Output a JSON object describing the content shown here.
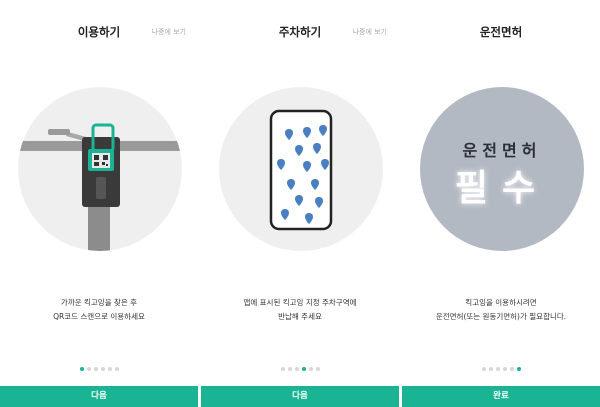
{
  "panels": [
    {
      "title": "이용하기",
      "skip_label": "나중에 보기",
      "description_lines": [
        "가까운 킥고잉을 찾은 후",
        "QR코드 스캔으로 이용하세요"
      ],
      "active_dot": 0,
      "button_label": "다음",
      "illustration": "scooter-qr"
    },
    {
      "title": "주차하기",
      "skip_label": "나중에 보기",
      "description_lines": [
        "앱에 표시된 킥고잉 지정 주차구역에",
        "반납해 주세요"
      ],
      "active_dot": 3,
      "button_label": "다음",
      "illustration": "phone-map-pins"
    },
    {
      "title": "운전면허",
      "description_lines": [
        "킥고잉을 이용하시려면",
        "운전면허(또는 원동기면허)가 필요합니다."
      ],
      "active_dot": 5,
      "button_label": "완료",
      "illustration": "license-required",
      "illustration_text_top": "운전면허",
      "illustration_text_big": "필수"
    }
  ],
  "dot_count": 6,
  "colors": {
    "accent": "#1ab394",
    "circle_bg": "#efefef",
    "license_circle_bg": "#b3b9c3",
    "dot_inactive": "#d6d6d6"
  }
}
